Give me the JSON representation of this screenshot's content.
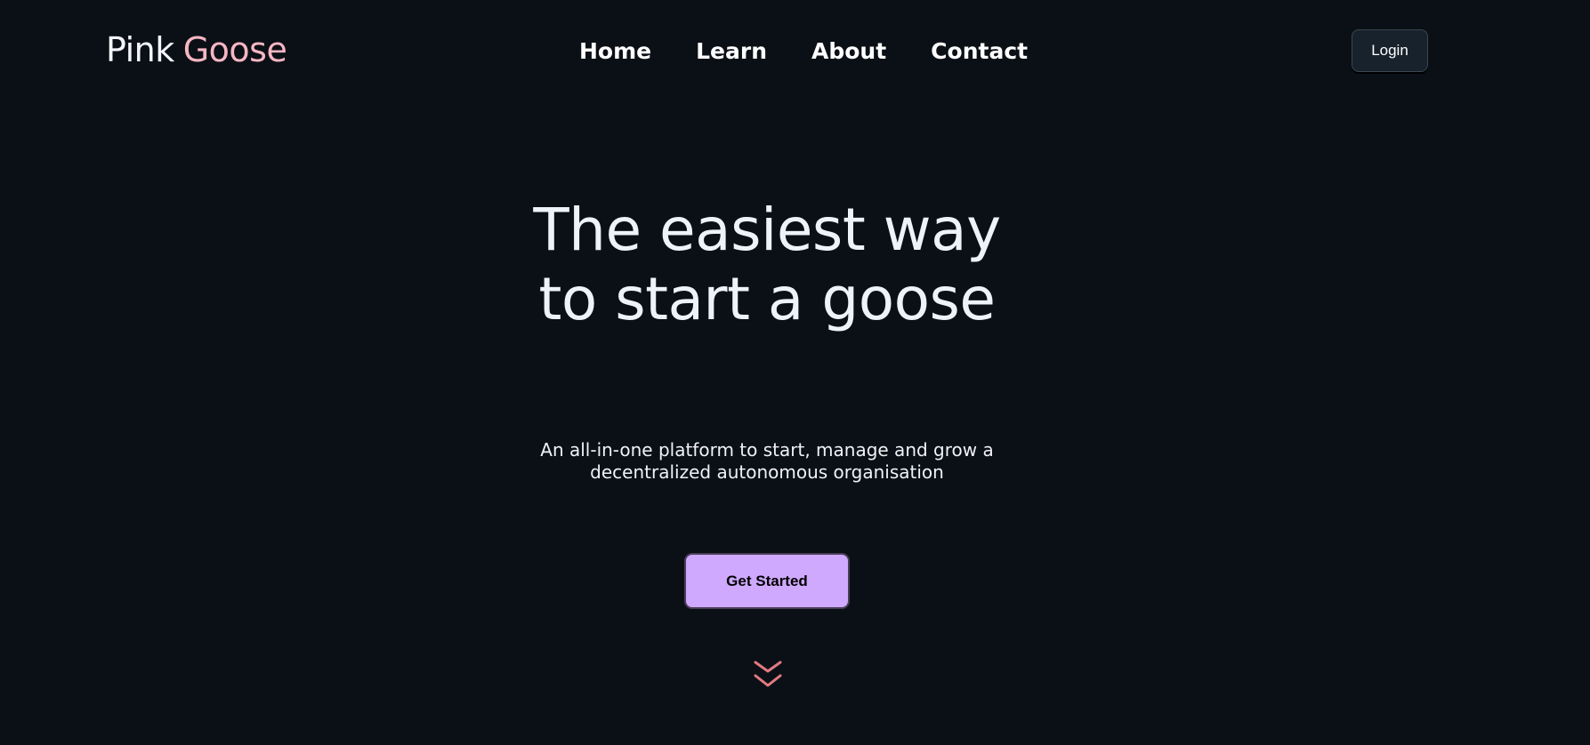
{
  "brand": {
    "name_part1": "Pink",
    "name_part2": "Goose",
    "colors": {
      "part1": "#f3f5fb",
      "part2": "#f6b6c3"
    }
  },
  "nav": {
    "items": [
      {
        "label": "Home"
      },
      {
        "label": "Learn"
      },
      {
        "label": "About"
      },
      {
        "label": "Contact"
      }
    ]
  },
  "header": {
    "login_label": "Login"
  },
  "hero": {
    "title_line1": "The easiest way",
    "title_line2": "to start a goose",
    "subtitle_line1": "An all-in-one platform to start, manage and grow a",
    "subtitle_line2": "decentralized autonomous organisation",
    "cta_label": "Get Started",
    "scroll_icon": "double-chevron-down-icon"
  },
  "colors": {
    "background": "#0b1016",
    "cta_background": "#cfa9fd",
    "chevron": "#e07a82",
    "login_background": "#17222c"
  }
}
